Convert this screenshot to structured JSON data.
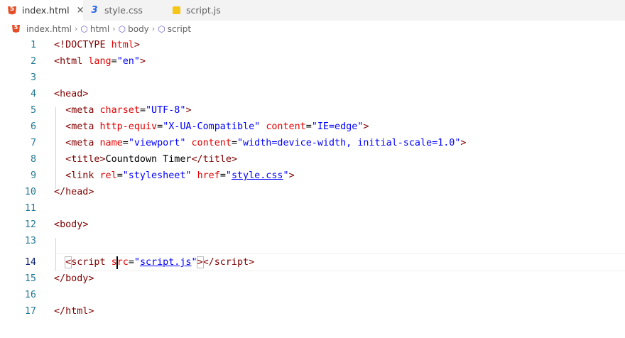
{
  "tabs": [
    {
      "label": "index.html",
      "close": "×"
    },
    {
      "label": "style.css"
    },
    {
      "label": "script.js"
    }
  ],
  "breadcrumb": {
    "file": "index.html",
    "separator": "›",
    "items": [
      "html",
      "body",
      "script"
    ]
  },
  "editor": {
    "active_line": 14,
    "lines": [
      {
        "num": "1"
      },
      {
        "num": "2"
      },
      {
        "num": "3"
      },
      {
        "num": "4"
      },
      {
        "num": "5"
      },
      {
        "num": "6"
      },
      {
        "num": "7"
      },
      {
        "num": "8"
      },
      {
        "num": "9"
      },
      {
        "num": "10"
      },
      {
        "num": "11"
      },
      {
        "num": "12"
      },
      {
        "num": "13"
      },
      {
        "num": "14"
      },
      {
        "num": "15"
      },
      {
        "num": "16"
      },
      {
        "num": "17"
      }
    ],
    "code": {
      "l1": {
        "open": "<!",
        "tag": "DOCTYPE",
        "sp": " ",
        "attr": "html",
        "close": ">"
      },
      "l2": {
        "open": "<",
        "tag": "html",
        "sp": " ",
        "attr": "lang",
        "eq": "=",
        "val": "\"en\"",
        "close": ">"
      },
      "l4": {
        "open": "<",
        "tag": "head",
        "close": ">"
      },
      "l5": {
        "indent": "  ",
        "open": "<",
        "tag": "meta",
        "sp": " ",
        "attr": "charset",
        "eq": "=",
        "val": "\"UTF-8\"",
        "close": ">"
      },
      "l6": {
        "indent": "  ",
        "open": "<",
        "tag": "meta",
        "sp": " ",
        "attr1": "http-equiv",
        "eq1": "=",
        "val1": "\"X-UA-Compatible\"",
        "sp2": " ",
        "attr2": "content",
        "eq2": "=",
        "val2": "\"IE=edge\"",
        "close": ">"
      },
      "l7": {
        "indent": "  ",
        "open": "<",
        "tag": "meta",
        "sp": " ",
        "attr1": "name",
        "eq1": "=",
        "val1": "\"viewport\"",
        "sp2": " ",
        "attr2": "content",
        "eq2": "=",
        "val2": "\"width=device-width, initial-scale=1.0\"",
        "close": ">"
      },
      "l8": {
        "indent": "  ",
        "open": "<",
        "tag": "title",
        "close": ">",
        "text": "Countdown Timer",
        "endopen": "</",
        "endtag": "title",
        "endclose": ">"
      },
      "l9": {
        "indent": "  ",
        "open": "<",
        "tag": "link",
        "sp": " ",
        "attr1": "rel",
        "eq1": "=",
        "val1": "\"stylesheet\"",
        "sp2": " ",
        "attr2": "href",
        "eq2": "=",
        "q1": "\"",
        "link": "style.css",
        "q2": "\"",
        "close": ">"
      },
      "l10": {
        "open": "</",
        "tag": "head",
        "close": ">"
      },
      "l12": {
        "open": "<",
        "tag": "body",
        "close": ">"
      },
      "l14": {
        "indent": "  ",
        "open": "<",
        "tag": "script",
        "sp": " ",
        "attr": "src",
        "eq": "=",
        "q1": "\"",
        "link": "script.js",
        "q2": "\"",
        "close": ">",
        "endopen": "</",
        "endtag": "script",
        "endclose": ">"
      },
      "l15": {
        "open": "</",
        "tag": "body",
        "close": ">"
      },
      "l17": {
        "open": "</",
        "tag": "html",
        "close": ">"
      }
    }
  },
  "colors": {
    "tag": "#800000",
    "attribute": "#e50000",
    "value": "#0000ff",
    "line_number": "#237893",
    "line_number_active": "#0b216f",
    "tabbar_bg": "#f3f3f3",
    "html_icon": "#e44d26",
    "css_icon": "#2965f1",
    "js_icon": "#f5c518"
  },
  "icons": {
    "tab_0": "html5-icon",
    "tab_1": "css3-icon",
    "tab_2": "javascript-icon",
    "breadcrumb_file": "html5-icon",
    "breadcrumb_item": "symbol-cube-icon"
  }
}
